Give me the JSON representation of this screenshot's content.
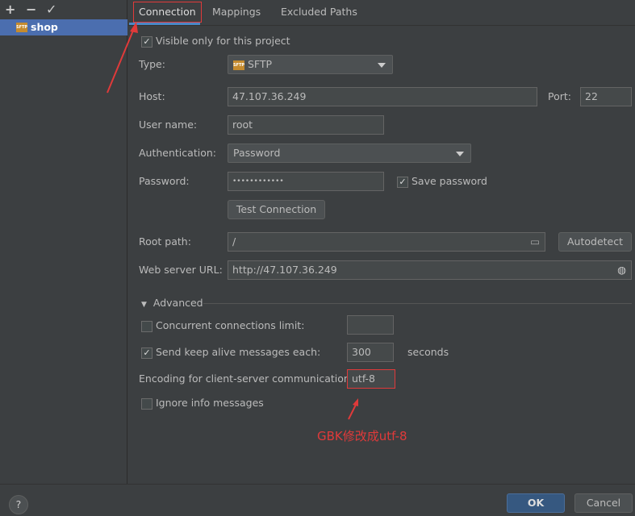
{
  "toolbar": {
    "add": "+",
    "remove": "−",
    "apply": "✓"
  },
  "sidebar": {
    "items": [
      {
        "label": "shop",
        "icon": "sftp-icon",
        "selected": true
      }
    ],
    "sftp_badge": "SFTP"
  },
  "tabs": [
    {
      "label": "Connection",
      "active": true
    },
    {
      "label": "Mappings"
    },
    {
      "label": "Excluded Paths"
    }
  ],
  "form": {
    "visible_only": {
      "label": "Visible only for this project",
      "checked": true
    },
    "type": {
      "label": "Type:",
      "value": "SFTP"
    },
    "host": {
      "label": "Host:",
      "value": "47.107.36.249"
    },
    "port": {
      "label": "Port:",
      "value": "22"
    },
    "username": {
      "label": "User name:",
      "value": "root"
    },
    "auth": {
      "label": "Authentication:",
      "value": "Password"
    },
    "password": {
      "label": "Password:",
      "value": "••••••••••••"
    },
    "save_password": {
      "label": "Save password",
      "checked": true
    },
    "test_connection": "Test Connection",
    "root_path": {
      "label": "Root path:",
      "value": "/"
    },
    "autodetect": "Autodetect",
    "web_url": {
      "label": "Web server URL:",
      "value": "http://47.107.36.249"
    }
  },
  "advanced": {
    "title": "Advanced",
    "concurrent": {
      "label": "Concurrent connections limit:",
      "checked": false,
      "value": ""
    },
    "keepalive": {
      "label": "Send keep alive messages each:",
      "checked": true,
      "value": "300",
      "unit": "seconds"
    },
    "encoding": {
      "label": "Encoding for client-server communication:",
      "value": "utf-8"
    },
    "ignore_info": {
      "label": "Ignore info messages",
      "checked": false
    }
  },
  "annotation": "GBK修改成utf-8",
  "footer": {
    "help": "?",
    "ok": "OK",
    "cancel": "Cancel"
  },
  "colors": {
    "accent": "#4a88c7",
    "annotation": "#e03a3a",
    "ok": "#365880"
  }
}
